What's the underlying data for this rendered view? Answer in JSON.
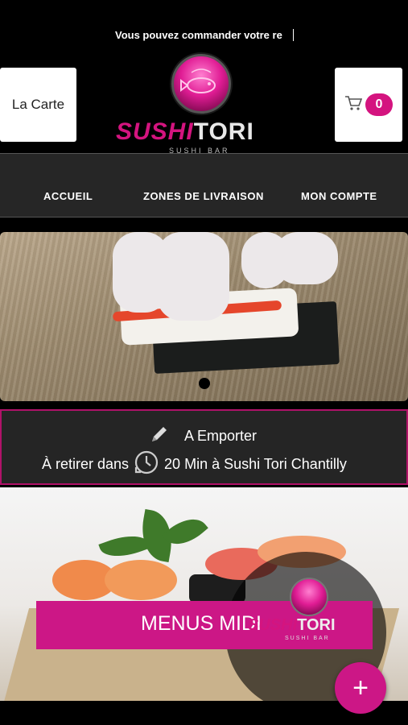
{
  "ticker": {
    "text": "Vous pouvez commander votre re"
  },
  "header": {
    "menu_button_label": "La Carte",
    "cart_count": "0",
    "logo_word_a": "SUSHI",
    "logo_word_b": "TORI",
    "logo_sub": "SUSHI BAR"
  },
  "nav": {
    "items": [
      {
        "label": "ACCUEIL"
      },
      {
        "label": "ZONES DE LIVRAISON"
      },
      {
        "label": "MON COMPTE"
      }
    ]
  },
  "order": {
    "mode_label": "A Emporter",
    "pickup_prefix": "À retirer dans",
    "pickup_detail": "20 Min à Sushi Tori Chantilly"
  },
  "promo": {
    "banner_label": "MENUS MIDI"
  },
  "fab": {
    "label": "+"
  },
  "colors": {
    "accent": "#cc1786",
    "background": "#000000",
    "nav_bg": "#262626"
  },
  "icons": [
    "cart-icon",
    "pencil-icon",
    "clock-icon",
    "plus-icon"
  ]
}
